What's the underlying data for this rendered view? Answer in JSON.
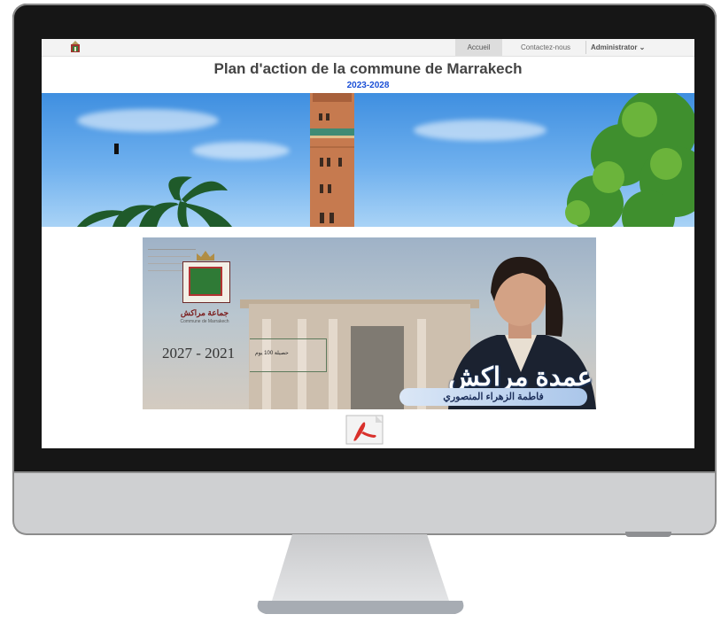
{
  "nav": {
    "home": "Accueil",
    "contact": "Contactez-nous",
    "admin": "Administrator ⌄"
  },
  "header": {
    "title": "Plan d'action de la commune de Marrakech",
    "years": "2023-2028"
  },
  "poster": {
    "commune_ar": "جماعة مراكش",
    "commune_fr": "Commune de Marrakech",
    "years": "2027 - 2021",
    "badge": "حصيلة 100 يوم",
    "title_ar": "عمدة مراكش",
    "name_ar": "فاطمة الزهراء المنصوري"
  },
  "colors": {
    "accent_blue": "#1a4fd6",
    "nav_active": "#dddddd",
    "pdf_red": "#d9302b"
  },
  "icons": {
    "site_logo": "municipal-emblem-icon",
    "document": "pdf-icon"
  }
}
